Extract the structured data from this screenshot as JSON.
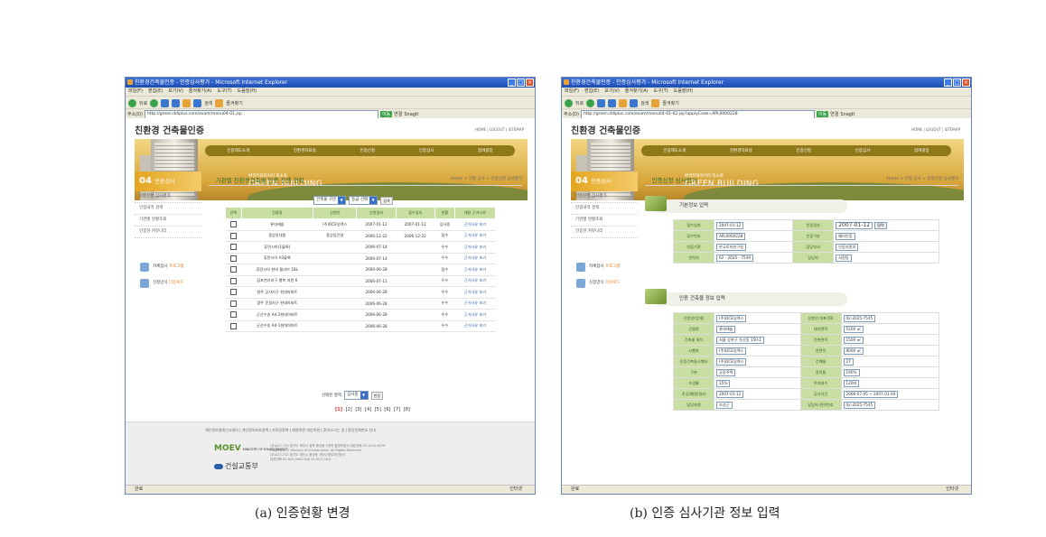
{
  "common": {
    "menu": [
      "파일(F)",
      "편집(E)",
      "보기(V)",
      "즐겨찾기(A)",
      "도구(T)",
      "도움말(H)"
    ],
    "toolbar": {
      "back": "뒤로",
      "search": "검색",
      "favorites": "즐겨찾기"
    },
    "address_label": "주소(D)",
    "go_label": "이동",
    "links_label": "연결",
    "snagit": "SnagIt",
    "site_title": "친환경 건축물인증",
    "toplinks": "HOME | LOGOUT | SITEMAP",
    "gnb": [
      "인증제도소개",
      "친환경자료실",
      "인증신청",
      "인증심사",
      "참여광장"
    ],
    "banner_tag": "환경친화적이며 최소화",
    "banner_big": "GREEN BUILDING",
    "lnb": {
      "number": "04",
      "title": "인증심사",
      "items": [
        "인증신청 심사평가",
        "인증내역 검색",
        "기관별 현황조회",
        "인증현 커뮤니티"
      ],
      "btn1_text": "자체점사 ",
      "btn1_accent": "프로그램",
      "btn2_text": "신청양식 ",
      "btn2_accent": "다운로드"
    },
    "status_left": "완료",
    "status_zone": "인터넷"
  },
  "shot_a": {
    "window_title": "친환경건축물인증 - 인증심사평가 - Microsoft Internet Explorer",
    "url": "http://green.ddiplus.com/exam/menu04-01.jsp",
    "content_title": "기관별 친환경건축물 인증 진행 현황",
    "location": "Home > 인증 심사 > 인증신청 심사평가",
    "filter_select1": "건축물 구분",
    "filter_select2": "등급 선택",
    "filter_btn": "검색",
    "table_headers": [
      "선택",
      "건물명",
      "신청인",
      "신청일자",
      "접수일자",
      "현황",
      "채용 근거사유"
    ],
    "rows": [
      [
        "롯데캐슬",
        "(주)DCE일렉스",
        "2007-01-12",
        "2007-01-12",
        "심사중",
        "근거사유 보기"
      ],
      [
        "중앙동대원",
        "중앙동건설",
        "2006-12-22",
        "2006-12-22",
        "접수",
        "근거사유 보기"
      ],
      [
        "휴먼시아(1블록)",
        "",
        "2006-07-14",
        "",
        "우수",
        "근거사유 보기"
      ],
      [
        "휴먼시아 A3블록",
        "",
        "2006-07-14",
        "",
        "우수",
        "근거사유 보기"
      ],
      [
        "휴먼시아 현대 올리브 1BL",
        "",
        "2006-06-28",
        "",
        "접수",
        "근거사유 보기"
      ],
      [
        "감포천가지구 행복 자연 6",
        "",
        "2006-07-11",
        "",
        "우수",
        "근거사유 보기"
      ],
      [
        "청주 공사지구 현대아파트",
        "",
        "2006-06-28",
        "",
        "우수",
        "근거사유 보기"
      ],
      [
        "광주 운정지구 현대아파트",
        "",
        "2006-06-28",
        "",
        "우수",
        "근거사유 보기"
      ],
      [
        "군산수송 A4-2현대아파트",
        "",
        "2006-06-28",
        "",
        "우수",
        "근거사유 보기"
      ],
      [
        "군산수송 A4-1현대아파트",
        "",
        "2006-06-28",
        "",
        "우수",
        "근거사유 보기"
      ]
    ],
    "bottom_label": "선택된 항목",
    "bottom_select": "심사중",
    "bottom_btn": "변경",
    "paging": [
      "[1]",
      "[2]",
      "[3]",
      "[4]",
      "[5]",
      "[6]",
      "[7]",
      "[8]"
    ],
    "footer_links": "개인정보침해신고센터 | 개인정보보호정책 | 저작권정책 | 회원약관 개인약관 | 찾아오시는 길 | 중앙전화번호 안내",
    "logo1": "MOEV",
    "logo1_sub": "MINISTRY OF ENVIRONMENT",
    "logo2": "건설교통부",
    "address_lines": [
      "(우)427-729 경기도 과천시 정부 중앙동 1번지 환경부청사 대표전화 02-2110-6579",
      "Copyright © Ministry of Environment, All Rights Reserved",
      "(우)427-712 경기도 과천시 중앙동 1번지 정부과천청사",
      "대표전화 02-503-9000 FAX 02-503-7402"
    ]
  },
  "shot_b": {
    "window_title": "친환경건축물인증 - 인증심사평가 - Microsoft Internet Explorer",
    "url": "http://green.ddiplus.com/exam/menu04-01-02.jsp?applyCode=APL0000228",
    "content_title": "인증신청 심사평가",
    "location": "Home > 인증 심사 > 인증신청 심사평가",
    "section1": "기본정보 입력",
    "basic_rows": [
      [
        "접수일자",
        "2007-01-12",
        "인증일자",
        "2007-01-12"
      ],
      [
        "접수번호",
        "APL0000228",
        "인증구분",
        "예비인증"
      ],
      [
        "인증기관",
        "한국토지연구원",
        "담당부서",
        "인증지원부"
      ],
      [
        "연락처",
        "02 - 2025 - 7549",
        "담당자",
        "서원동"
      ]
    ],
    "calendar_btn": "달력",
    "section2": "인증 건축물 정보 입력",
    "bldg_rows": [
      [
        "신청인(업체)",
        "(주)DCE일렉스",
        "신청인 대표전화",
        "02-2025-7545"
      ],
      [
        "건물명",
        "롯데캐슬",
        "대지면적",
        "5200 ㎡"
      ],
      [
        "건축물 위치",
        "서울 강관구 가산동 150-1",
        "건축면적",
        "1500 ㎡"
      ],
      [
        "시행자",
        "(주)DCE일렉스",
        "연면적",
        "8000 ㎡"
      ],
      [
        "인증건축물시행자",
        "(주)DCE일렉스",
        "건폐율",
        "27"
      ],
      [
        "구분",
        "공동주택",
        "용적율",
        "190%"
      ],
      [
        "조경율",
        "25%",
        "주차대수",
        "120대"
      ],
      [
        "준공(예정)일자",
        "2007-01-12",
        "공사기간",
        "2006-07-05 ~ 2007-01-04"
      ],
      [
        "담당자명",
        "조성근",
        "담당자 연락번호",
        "02-2025-7545"
      ]
    ]
  },
  "captions": {
    "a": "(a) 인증현황 변경",
    "b": "(b) 인증 심사기관 정보 입력"
  }
}
